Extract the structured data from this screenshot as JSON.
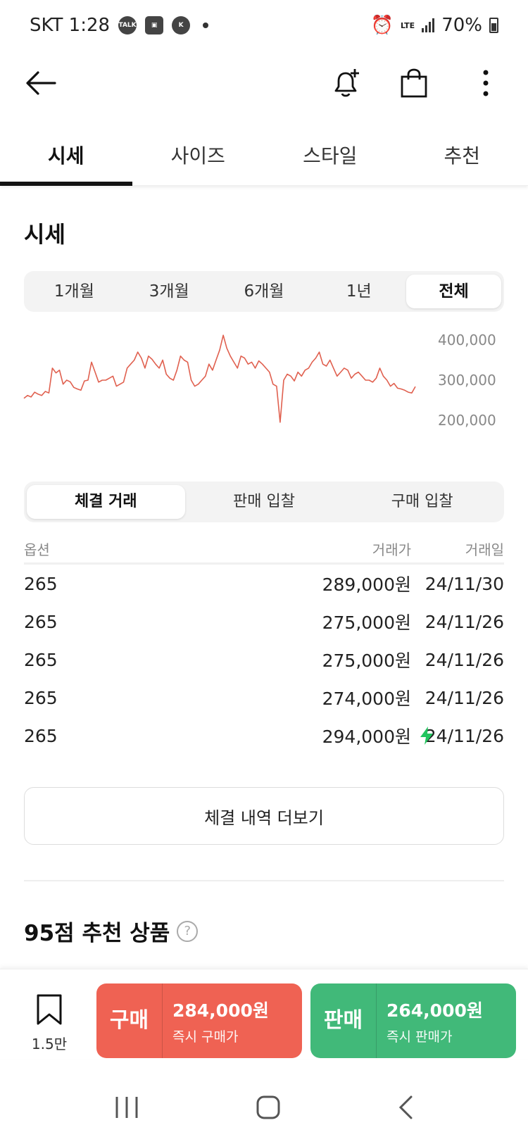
{
  "status_bar": {
    "carrier_time": "SKT 1:28",
    "network": "LTE",
    "battery": "70%"
  },
  "tabs": [
    {
      "label": "시세",
      "active": true
    },
    {
      "label": "사이즈",
      "active": false
    },
    {
      "label": "스타일",
      "active": false
    },
    {
      "label": "추천",
      "active": false
    }
  ],
  "section_title": "시세",
  "periods": [
    {
      "label": "1개월",
      "active": false
    },
    {
      "label": "3개월",
      "active": false
    },
    {
      "label": "6개월",
      "active": false
    },
    {
      "label": "1년",
      "active": false
    },
    {
      "label": "전체",
      "active": true
    }
  ],
  "chart_data": {
    "type": "line",
    "color": "#e0604f",
    "yticks": [
      "400,000",
      "300,000",
      "200,000"
    ],
    "ylim": [
      200000,
      400000
    ],
    "values": [
      255000,
      262000,
      258000,
      270000,
      265000,
      262000,
      272000,
      268000,
      330000,
      318000,
      325000,
      290000,
      300000,
      296000,
      282000,
      278000,
      275000,
      298000,
      300000,
      345000,
      320000,
      295000,
      300000,
      300000,
      305000,
      310000,
      285000,
      290000,
      295000,
      330000,
      340000,
      350000,
      370000,
      355000,
      330000,
      360000,
      352000,
      340000,
      330000,
      350000,
      315000,
      305000,
      300000,
      325000,
      360000,
      350000,
      345000,
      300000,
      285000,
      290000,
      300000,
      310000,
      340000,
      325000,
      350000,
      375000,
      412000,
      380000,
      360000,
      345000,
      330000,
      360000,
      355000,
      340000,
      345000,
      330000,
      348000,
      340000,
      330000,
      320000,
      290000,
      285000,
      195000,
      300000,
      315000,
      310000,
      298000,
      320000,
      310000,
      325000,
      330000,
      345000,
      355000,
      370000,
      340000,
      335000,
      350000,
      330000,
      310000,
      320000,
      330000,
      325000,
      305000,
      315000,
      320000,
      310000,
      300000,
      300000,
      295000,
      305000,
      330000,
      310000,
      300000,
      285000,
      292000,
      280000,
      278000,
      275000,
      270000,
      268000,
      284000
    ]
  },
  "trade_tabs": [
    {
      "label": "체결 거래",
      "active": true
    },
    {
      "label": "판매 입찰",
      "active": false
    },
    {
      "label": "구매 입찰",
      "active": false
    }
  ],
  "table": {
    "headers": {
      "option": "옵션",
      "price": "거래가",
      "date": "거래일"
    },
    "rows": [
      {
        "option": "265",
        "price": "289,000원",
        "date": "24/11/30",
        "fast": false
      },
      {
        "option": "265",
        "price": "275,000원",
        "date": "24/11/26",
        "fast": false
      },
      {
        "option": "265",
        "price": "275,000원",
        "date": "24/11/26",
        "fast": false
      },
      {
        "option": "265",
        "price": "274,000원",
        "date": "24/11/26",
        "fast": false
      },
      {
        "option": "265",
        "price": "294,000원",
        "date": "24/11/26",
        "fast": true
      }
    ]
  },
  "more_button": "체결 내역 더보기",
  "recommend_title": "95점 추천 상품",
  "recommend_help": "?",
  "wish_count": "1.5만",
  "buy": {
    "label": "구매",
    "price": "284,000원",
    "sub": "즉시 구매가",
    "color": "#ef6253"
  },
  "sell": {
    "label": "판매",
    "price": "264,000원",
    "sub": "즉시 판매가",
    "color": "#41b979"
  }
}
